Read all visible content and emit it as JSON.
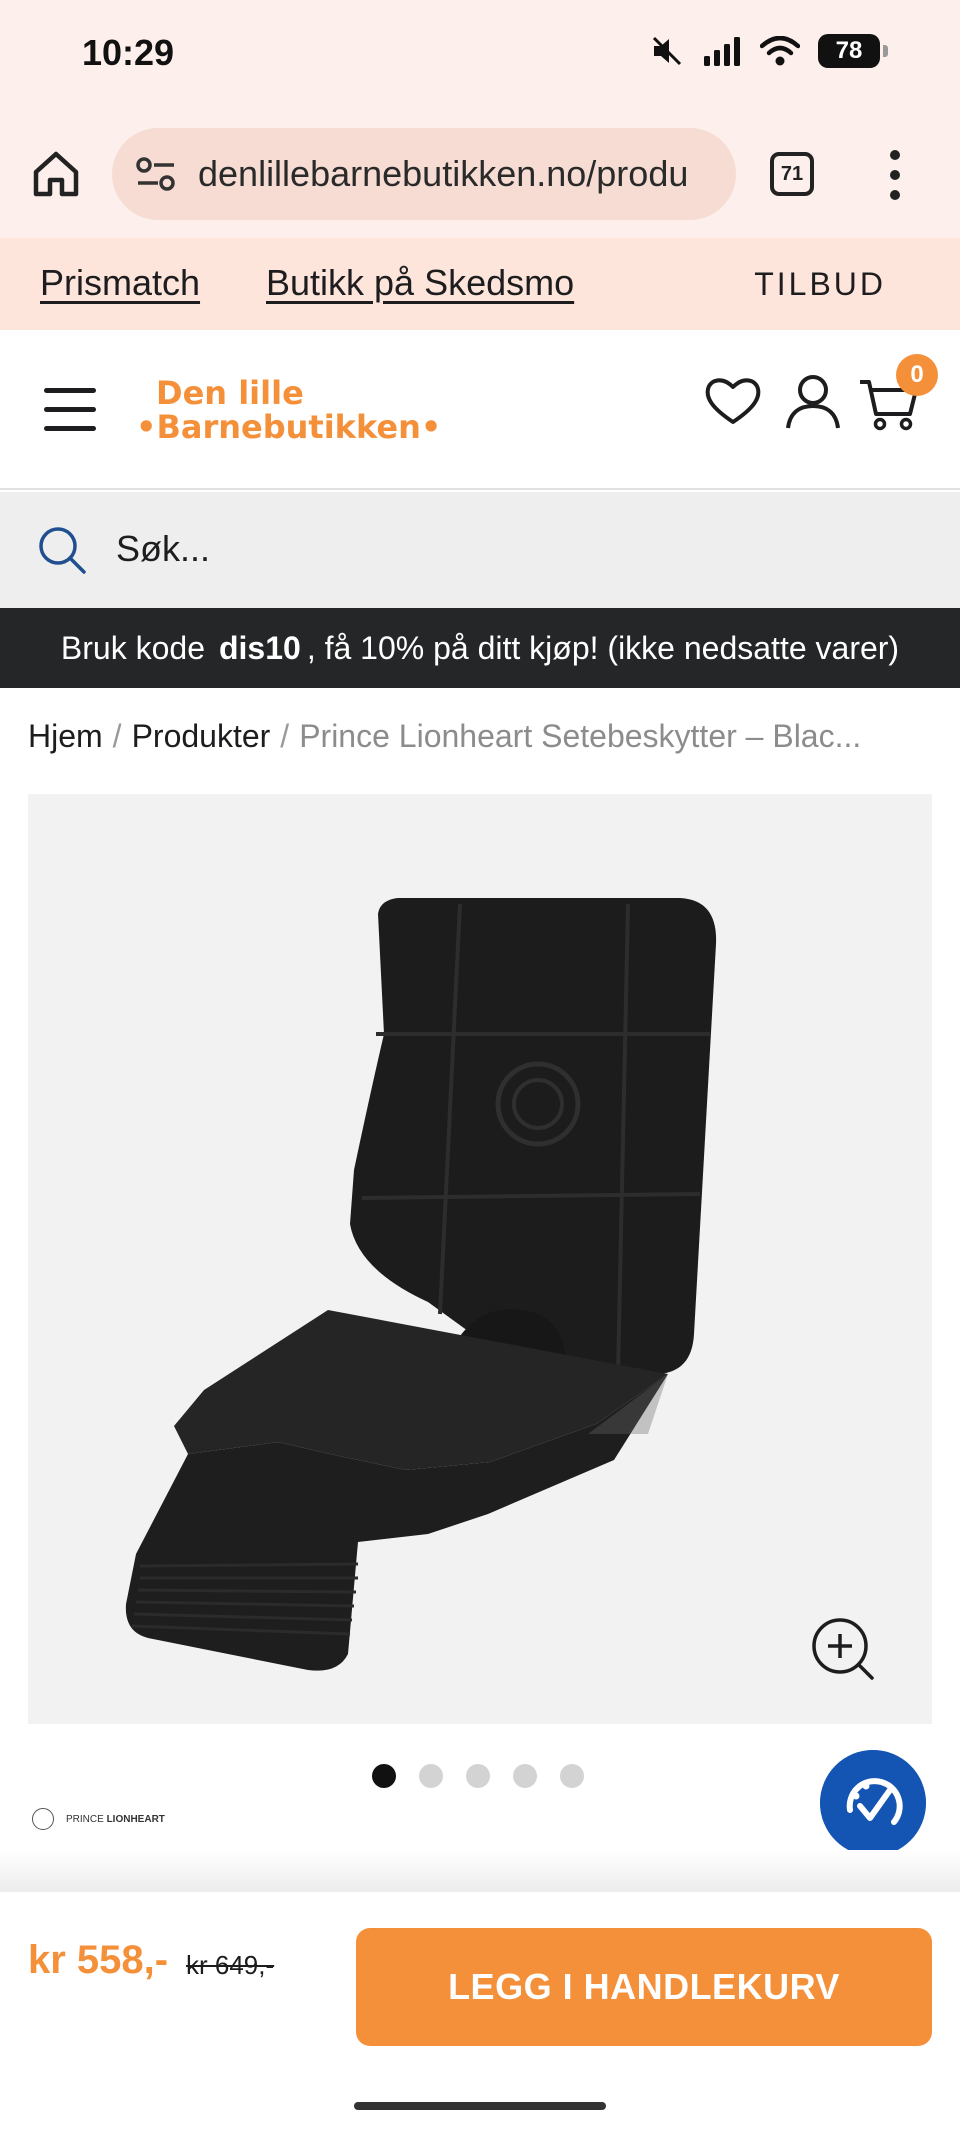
{
  "status_bar": {
    "time": "10:29",
    "battery": "78"
  },
  "browser": {
    "url": "denlillebarnebutikken.no/produ",
    "tab_count": "71"
  },
  "promo_nav": {
    "prismatch": "Prismatch",
    "store": "Butikk på Skedsmo",
    "offers": "TILBUD"
  },
  "header": {
    "logo_line1": "Den lille",
    "logo_line2": "•Barnebutikken•",
    "cart_count": "0"
  },
  "search": {
    "placeholder": "Søk..."
  },
  "announcement": {
    "prefix": "Bruk kode",
    "code": "dis10",
    "suffix": ", få 10% på ditt kjøp! (ikke nedsatte varer)"
  },
  "breadcrumb": {
    "home": "Hjem",
    "products": "Produkter",
    "current": "Prince Lionheart Setebeskytter – Blac...",
    "separator": "/"
  },
  "gallery": {
    "dot_count": 5,
    "active_dot": 1
  },
  "brand": {
    "name_light": "PRINCE",
    "name_bold": "LIONHEART"
  },
  "purchase": {
    "price": "kr 558,-",
    "old_price": "kr 649,-",
    "add_to_cart": "LEGG I HANDLEKURV"
  },
  "colors": {
    "accent": "#f5903a",
    "announce_bg": "#252628",
    "fab": "#1455b4",
    "promo_bg": "#fde5db"
  }
}
